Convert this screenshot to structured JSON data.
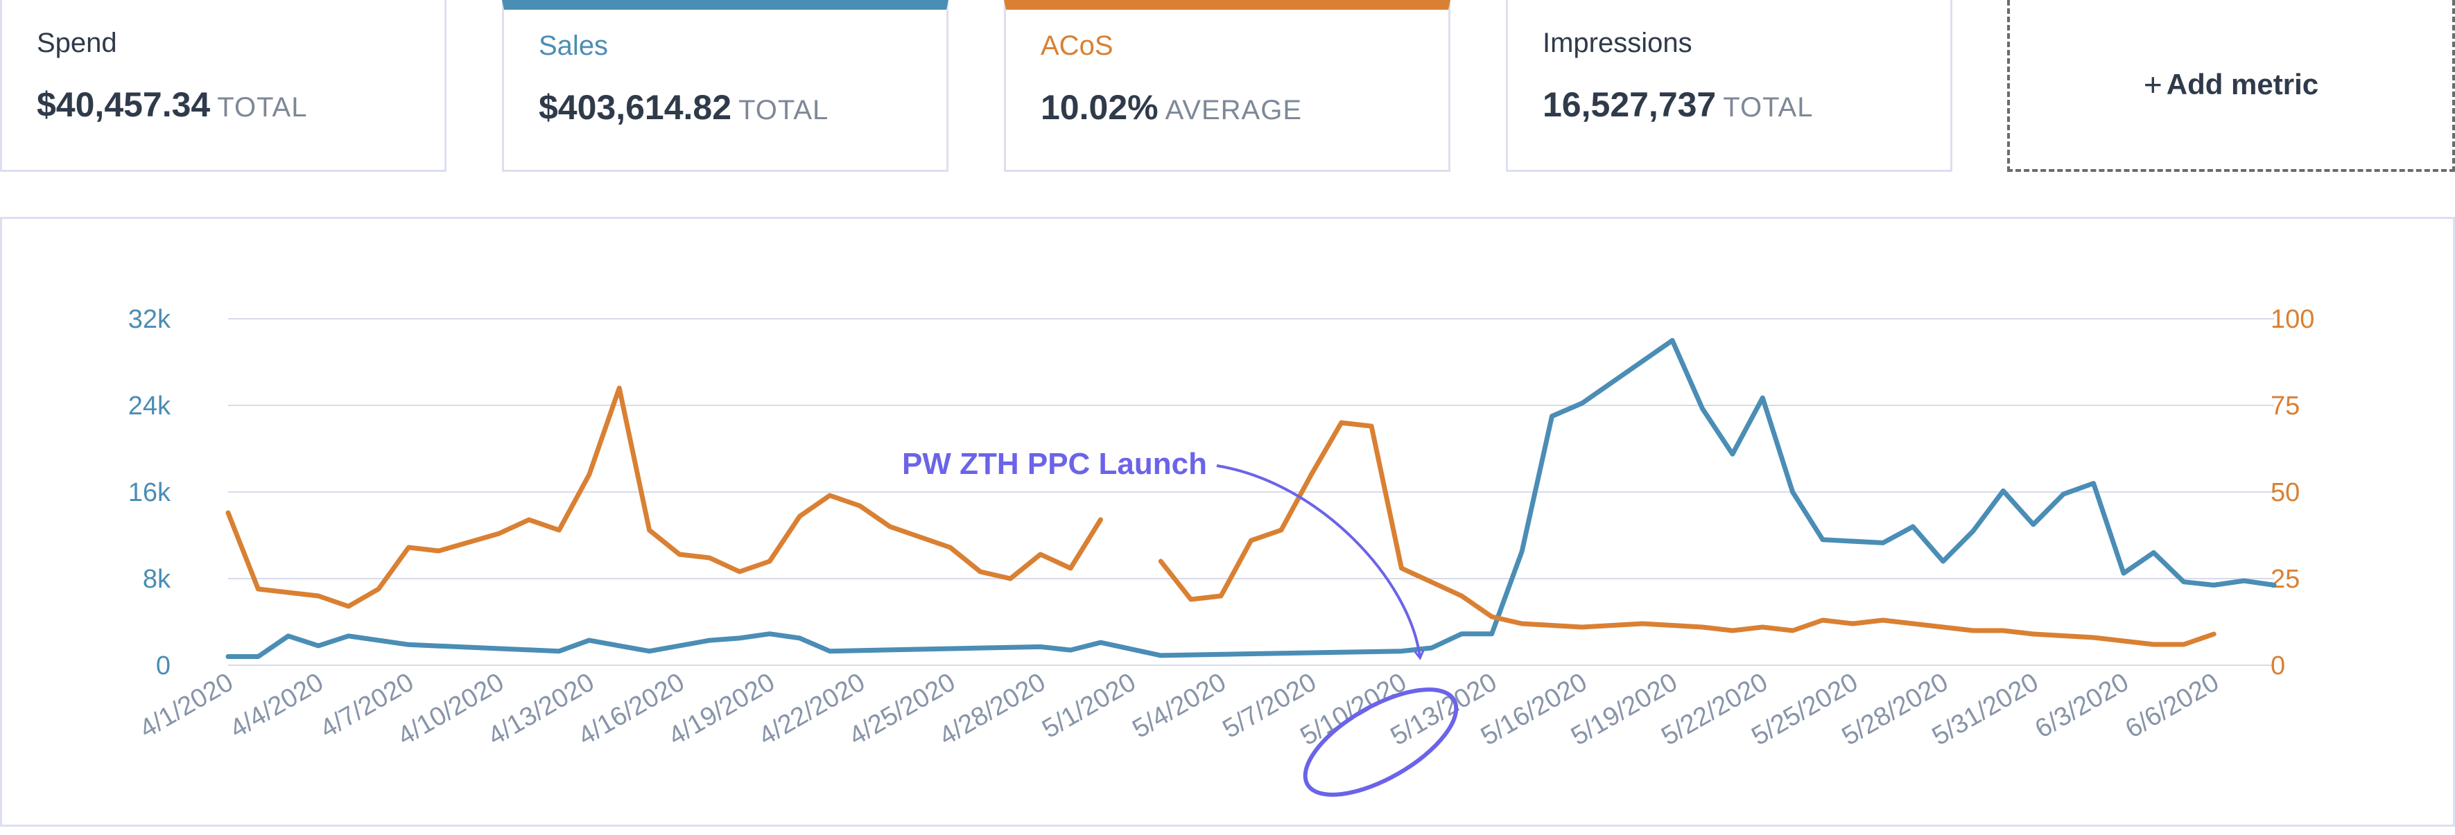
{
  "metrics": [
    {
      "label": "Spend",
      "value": "$40,457.34",
      "suffix": "TOTAL"
    },
    {
      "label": "Sales",
      "value": "$403,614.82",
      "suffix": "TOTAL",
      "accent": "#4a8db5"
    },
    {
      "label": "ACoS",
      "value": "10.02%",
      "suffix": "AVERAGE",
      "accent": "#d98033"
    },
    {
      "label": "Impressions",
      "value": "16,527,737",
      "suffix": "TOTAL"
    }
  ],
  "add_metric": {
    "plus": "+",
    "label": "Add metric"
  },
  "colors": {
    "sales": "#4a8db5",
    "acos": "#d98033",
    "annotation": "#6b63e8",
    "grid": "#d8dbea",
    "xtick": "#8794a8"
  },
  "chart_data": {
    "type": "line",
    "x_ticks": [
      "4/1/2020",
      "4/4/2020",
      "4/7/2020",
      "4/10/2020",
      "4/13/2020",
      "4/16/2020",
      "4/19/2020",
      "4/22/2020",
      "4/25/2020",
      "4/28/2020",
      "5/1/2020",
      "5/4/2020",
      "5/7/2020",
      "5/10/2020",
      "5/13/2020",
      "5/16/2020",
      "5/19/2020",
      "5/22/2020",
      "5/25/2020",
      "5/28/2020",
      "5/31/2020",
      "6/3/2020",
      "6/6/2020"
    ],
    "y_left": {
      "ticks": [
        "0",
        "8k",
        "16k",
        "24k",
        "32k"
      ],
      "range": [
        0,
        32000
      ]
    },
    "y_right": {
      "ticks": [
        "0",
        "25",
        "50",
        "75",
        "100"
      ],
      "range": [
        0,
        100
      ]
    },
    "series": [
      {
        "axis": "left",
        "points": [
          [
            "4/1/2020",
            800
          ],
          [
            "4/2/2020",
            800
          ],
          [
            "4/3/2020",
            2700
          ],
          [
            "4/4/2020",
            1800
          ],
          [
            "4/5/2020",
            2700
          ],
          [
            "4/7/2020",
            1900
          ],
          [
            "4/12/2020",
            1300
          ],
          [
            "4/13/2020",
            2300
          ],
          [
            "4/15/2020",
            1300
          ],
          [
            "4/17/2020",
            2300
          ],
          [
            "4/18/2020",
            2500
          ],
          [
            "4/19/2020",
            2900
          ],
          [
            "4/20/2020",
            2500
          ],
          [
            "4/21/2020",
            1300
          ],
          [
            "4/28/2020",
            1700
          ],
          [
            "4/29/2020",
            1400
          ],
          [
            "4/30/2020",
            2100
          ],
          [
            "5/1/2020",
            1500
          ],
          [
            "5/2/2020",
            900
          ],
          [
            "5/10/2020",
            1300
          ],
          [
            "5/11/2020",
            1600
          ],
          [
            "5/12/2020",
            2900
          ],
          [
            "5/13/2020",
            2900
          ],
          [
            "5/14/2020",
            10500
          ],
          [
            "5/15/2020",
            23000
          ],
          [
            "5/16/2020",
            24200
          ],
          [
            "5/19/2020",
            30000
          ],
          [
            "5/20/2020",
            23700
          ],
          [
            "5/21/2020",
            19500
          ],
          [
            "5/22/2020",
            24700
          ],
          [
            "5/23/2020",
            16000
          ],
          [
            "5/24/2020",
            11600
          ],
          [
            "5/26/2020",
            11300
          ],
          [
            "5/27/2020",
            12800
          ],
          [
            "5/28/2020",
            9600
          ],
          [
            "5/29/2020",
            12400
          ],
          [
            "5/30/2020",
            16100
          ],
          [
            "5/31/2020",
            13000
          ],
          [
            "6/1/2020",
            15800
          ],
          [
            "6/2/2020",
            16800
          ],
          [
            "6/3/2020",
            8500
          ],
          [
            "6/4/2020",
            10400
          ],
          [
            "6/5/2020",
            7700
          ],
          [
            "6/6/2020",
            7400
          ],
          [
            "6/7/2020",
            7800
          ],
          [
            "6/8/2020",
            7400
          ]
        ]
      },
      {
        "axis": "right",
        "segments": [
          [
            [
              "4/1/2020",
              44
            ],
            [
              "4/2/2020",
              22
            ],
            [
              "4/4/2020",
              20
            ],
            [
              "4/5/2020",
              17
            ],
            [
              "4/6/2020",
              22
            ],
            [
              "4/7/2020",
              34
            ],
            [
              "4/8/2020",
              33
            ],
            [
              "4/10/2020",
              38
            ],
            [
              "4/11/2020",
              42
            ],
            [
              "4/12/2020",
              39
            ],
            [
              "4/13/2020",
              55
            ],
            [
              "4/14/2020",
              80
            ],
            [
              "4/15/2020",
              39
            ],
            [
              "4/16/2020",
              32
            ],
            [
              "4/17/2020",
              31
            ],
            [
              "4/18/2020",
              27
            ],
            [
              "4/19/2020",
              30
            ],
            [
              "4/20/2020",
              43
            ],
            [
              "4/21/2020",
              49
            ],
            [
              "4/22/2020",
              46
            ],
            [
              "4/23/2020",
              40
            ],
            [
              "4/24/2020",
              37
            ],
            [
              "4/25/2020",
              34
            ],
            [
              "4/26/2020",
              27
            ],
            [
              "4/27/2020",
              25
            ],
            [
              "4/28/2020",
              32
            ],
            [
              "4/29/2020",
              28
            ],
            [
              "4/30/2020",
              42
            ]
          ],
          [
            [
              "5/2/2020",
              30
            ],
            [
              "5/3/2020",
              19
            ],
            [
              "5/4/2020",
              20
            ],
            [
              "5/5/2020",
              36
            ],
            [
              "5/6/2020",
              39
            ],
            [
              "5/7/2020",
              55
            ],
            [
              "5/8/2020",
              70
            ],
            [
              "5/9/2020",
              69
            ],
            [
              "5/10/2020",
              28
            ],
            [
              "5/11/2020",
              24
            ],
            [
              "5/12/2020",
              20
            ],
            [
              "5/13/2020",
              14
            ],
            [
              "5/14/2020",
              12
            ],
            [
              "5/16/2020",
              11
            ],
            [
              "5/18/2020",
              12
            ],
            [
              "5/20/2020",
              11
            ],
            [
              "5/21/2020",
              10
            ],
            [
              "5/22/2020",
              11
            ],
            [
              "5/23/2020",
              10
            ],
            [
              "5/24/2020",
              13
            ],
            [
              "5/25/2020",
              12
            ],
            [
              "5/26/2020",
              13
            ],
            [
              "5/27/2020",
              12
            ],
            [
              "5/28/2020",
              11
            ],
            [
              "5/29/2020",
              10
            ],
            [
              "5/30/2020",
              10
            ],
            [
              "5/31/2020",
              9
            ],
            [
              "6/2/2020",
              8
            ],
            [
              "6/3/2020",
              7
            ],
            [
              "6/4/2020",
              6
            ],
            [
              "6/5/2020",
              6
            ],
            [
              "6/6/2020",
              9
            ]
          ]
        ]
      }
    ],
    "annotations": [
      {
        "text": "PW ZTH PPC Launch",
        "target": "5/10/2020",
        "circled_tick": "5/10/2020"
      }
    ],
    "grid": true,
    "legend": "none"
  }
}
